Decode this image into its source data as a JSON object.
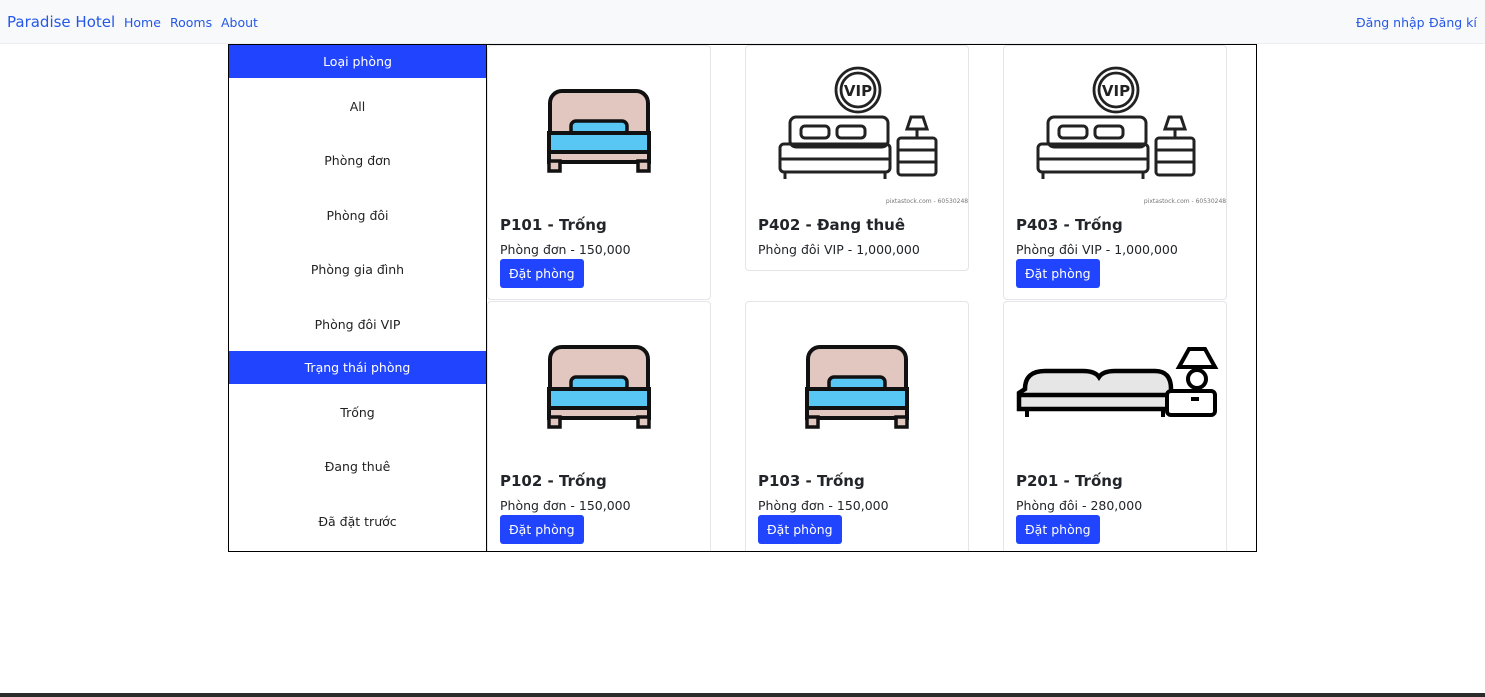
{
  "navbar": {
    "brand": "Paradise Hotel",
    "links": [
      "Home",
      "Rooms",
      "About"
    ],
    "login": "Đăng nhập",
    "register": "Đăng kí"
  },
  "sidebar": {
    "room_type_heading": "Loại phòng",
    "room_types": [
      "All",
      "Phòng đơn",
      "Phòng đôi",
      "Phòng gia đình",
      "Phòng đôi VIP"
    ],
    "status_heading": "Trạng thái phòng",
    "statuses": [
      "Trống",
      "Đang thuê",
      "Đã đặt trước"
    ]
  },
  "rooms": [
    {
      "title": "P101 - Trống",
      "info": "Phòng đơn - 150,000",
      "button": "Đặt phòng",
      "image": "single-bed-icon"
    },
    {
      "title": "P402 - Đang thuê",
      "info": "Phòng đôi VIP - 1,000,000",
      "image": "vip-bed-icon"
    },
    {
      "title": "P403 - Trống",
      "info": "Phòng đôi VIP - 1,000,000",
      "button": "Đặt phòng",
      "image": "vip-bed-icon"
    },
    {
      "title": "P102 - Trống",
      "info": "Phòng đơn - 150,000",
      "button": "Đặt phòng",
      "image": "single-bed-icon"
    },
    {
      "title": "P103 - Trống",
      "info": "Phòng đơn - 150,000",
      "button": "Đặt phòng",
      "image": "single-bed-icon"
    },
    {
      "title": "P201 - Trống",
      "info": "Phòng đôi - 280,000",
      "button": "Đặt phòng",
      "image": "double-bed-lamp-icon"
    }
  ],
  "image_watermark": "pixtastock.com - 60530248",
  "colors": {
    "accent": "#2145ff",
    "link": "#2557e8",
    "navbar_bg": "#f8f9fa"
  }
}
